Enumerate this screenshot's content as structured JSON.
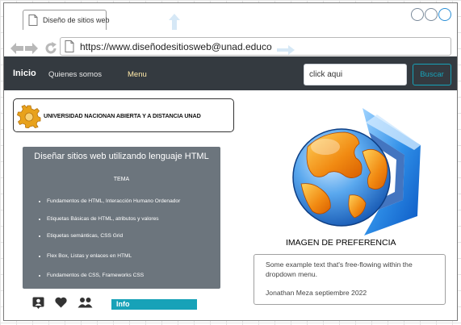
{
  "browser": {
    "tab_title": "Diseño de sitios web",
    "url": "https://www.diseñodesitiosweb@unad.educo"
  },
  "navbar": {
    "brand": "Inicio",
    "links": [
      "Quienes somos",
      "Menu"
    ],
    "search_value": "click aqui",
    "search_button": "Buscar"
  },
  "university": {
    "name": "UNIVERSIDAD NACIONAN ABIERTA Y A DISTANCIA UNAD"
  },
  "course_card": {
    "title": "Diseñar sitios web utilizando lenguaje HTML",
    "subtitle": "TEMA",
    "topics": [
      "Fundamentos de HTML, Interacción Humano Ordenador",
      "Etiquetas Básicas de HTML, atributos y valores",
      "Etiquetas semánticas, CSS Grid",
      "Flex Box, Listas y enlaces en HTML",
      "Fundamentos de CSS, Frameworks CSS"
    ]
  },
  "footer_icons": [
    "contact-card-icon",
    "heart-icon",
    "people-icon"
  ],
  "info_label": "Info",
  "image_caption": "IMAGEN DE PREFERENCIA",
  "dropdown": {
    "text": "Some example text that's free-flowing within the dropdown menu.",
    "author": "Jonathan Meza septiembre 2022"
  },
  "colors": {
    "navbar_bg": "#343a40",
    "card_bg": "#6c757d",
    "accent_info": "#17a2b8",
    "menu_link": "#ffe9a8"
  }
}
